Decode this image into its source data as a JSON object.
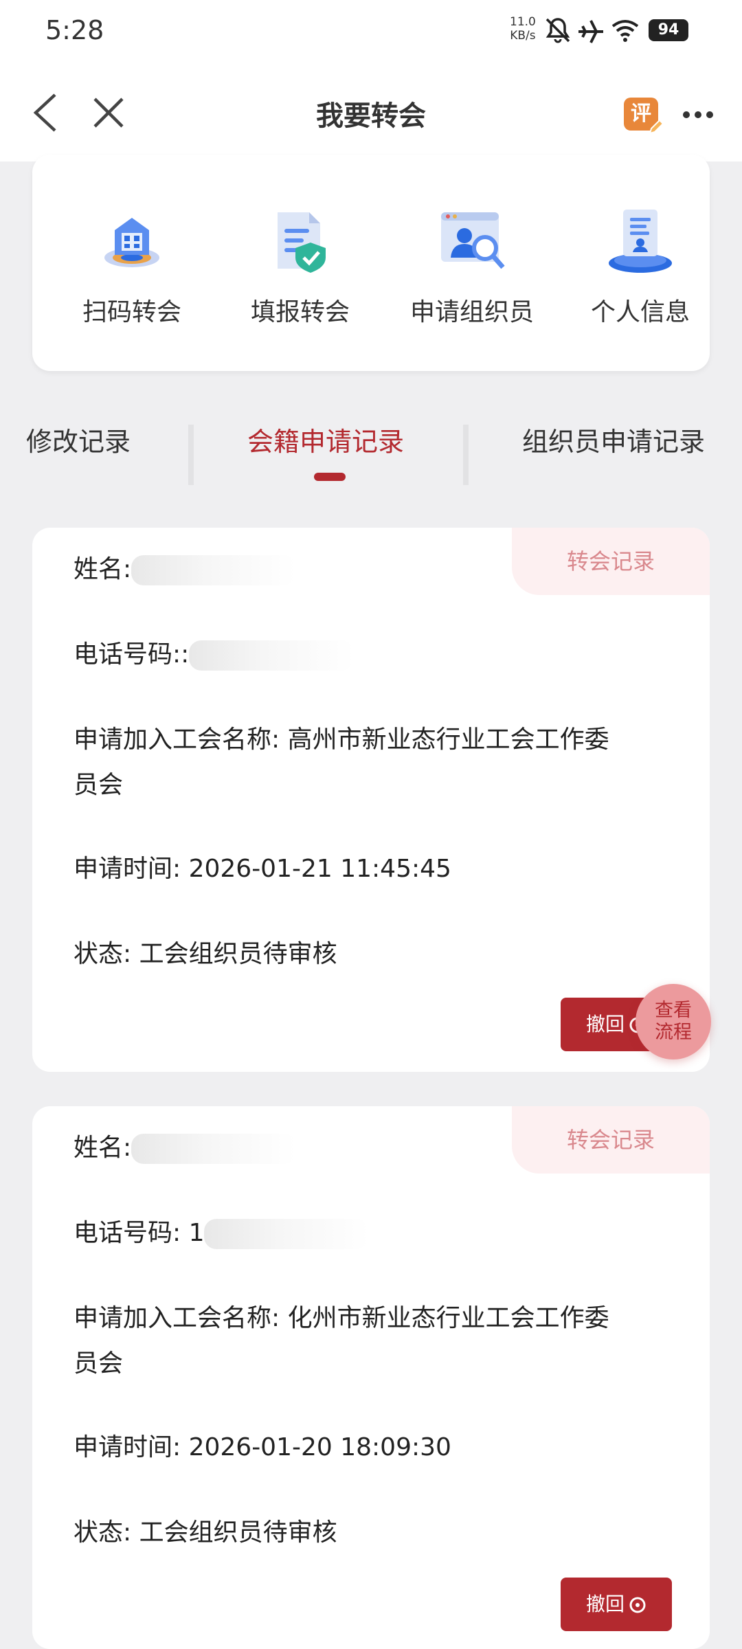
{
  "status_bar": {
    "time": "5:28",
    "speed_value": "11.0",
    "speed_unit": "KB/s",
    "battery": "94"
  },
  "nav": {
    "title": "我要转会",
    "review_badge": "评"
  },
  "quick_actions": [
    {
      "label": "扫码转会",
      "icon": "qr-scan-icon"
    },
    {
      "label": "填报转会",
      "icon": "form-check-icon"
    },
    {
      "label": "申请组织员",
      "icon": "organizer-search-icon"
    },
    {
      "label": "个人信息",
      "icon": "profile-document-icon"
    }
  ],
  "tabs": [
    {
      "label": "修改记录",
      "active": false
    },
    {
      "label": "会籍申请记录",
      "active": true
    },
    {
      "label": "组织员申请记录",
      "active": false
    }
  ],
  "records": [
    {
      "badge": "转会记录",
      "name_label": "姓名:",
      "phone_label": "电话号码::",
      "union_line1": "申请加入工会名称: 高州市新业态行业工会工作委",
      "union_line2": "员会",
      "time_line": "申请时间: 2026-01-21 11:45:45",
      "status_line": "状态: 工会组织员待审核",
      "withdraw_label": "撤回"
    },
    {
      "badge": "转会记录",
      "name_label": "姓名:",
      "phone_label": "电话号码: 1",
      "union_line1": "申请加入工会名称: 化州市新业态行业工会工作委",
      "union_line2": "员会",
      "time_line": "申请时间: 2026-01-20 18:09:30",
      "status_line": "状态: 工会组织员待审核",
      "withdraw_label": "撤回"
    }
  ],
  "fab": {
    "label": "查看流程"
  },
  "colors": {
    "accent": "#b3292f",
    "badge_bg": "#fdf0f1",
    "badge_text": "#d9888d",
    "page_bg": "#efeff1"
  }
}
